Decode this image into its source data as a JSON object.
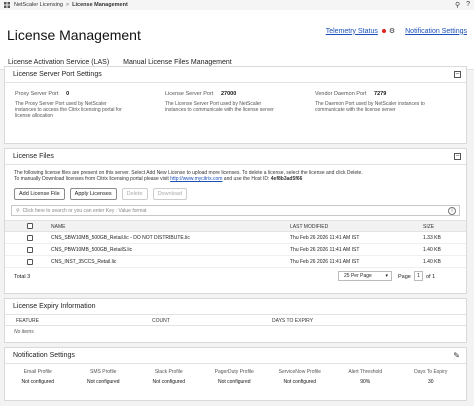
{
  "topbar": {
    "app": "NetScaler Licensing",
    "separator": ">",
    "current": "License Management"
  },
  "header": {
    "title": "License Management",
    "telemetry_link": "Telemetry Status",
    "notification_link": "Notification Settings",
    "telemetry_dot_color": "#e2231a"
  },
  "tabs": [
    {
      "label": "License Activation Service (LAS)"
    },
    {
      "label": "Manual License Files Management"
    }
  ],
  "ports_panel": {
    "title": "License Server Port Settings",
    "items": [
      {
        "label": "Proxy Server Port",
        "value": "0",
        "desc": "The Proxy Server Port used by NetScaler instances to access the Citrix licensing portal for license allocation"
      },
      {
        "label": "License Server Port",
        "value": "27000",
        "desc": "The License Server Port used by NetScaler instances to communicate with the license server"
      },
      {
        "label": "Vendor Daemon Port",
        "value": "7279",
        "desc": "The Daemon Port used by NetScaler instances to communicate with the license server"
      }
    ]
  },
  "files_panel": {
    "title": "License Files",
    "desc_line1": "The following license files are present on this server. Select Add New License to upload more licenses. To delete a license, select the license and click Delete.",
    "desc_line2_prefix": "To manually Download licenses from Citrix licensing portal please visit ",
    "desc_link": "http://www.mycitrix.com",
    "desc_line2_suffix": " and use the Host ID: ",
    "host_id": "4ef8b3ad5f66",
    "buttons": {
      "add": "Add License File",
      "apply": "Apply Licenses",
      "delete": "Delete",
      "download": "Download"
    },
    "search_placeholder": "Click here to search or you can enter Key : Value format",
    "columns": {
      "name": "NAME",
      "modified": "LAST MODIFIED",
      "size": "SIZE"
    },
    "rows": [
      {
        "name": "CNS_SBW10MB_500GB_Retail.lic - DO NOT DISTRIBUTE.lic",
        "modified": "Thu Feb 26 2026 11:41 AM IST",
        "size": "1.33 KB"
      },
      {
        "name": "CNS_PBW10MB_500GB_RetailS.lic",
        "modified": "Thu Feb 26 2026 11:41 AM IST",
        "size": "1.40 KB"
      },
      {
        "name": "CNS_INST_35CCS_Retail.lic",
        "modified": "Thu Feb 26 2026 11:41 AM IST",
        "size": "1.40 KB"
      }
    ],
    "total": "Total 3",
    "per_page": "25 Per Page",
    "page_label": "Page",
    "page_value": "1",
    "of_label": "of 1"
  },
  "expiry_panel": {
    "title": "License Expiry Information",
    "columns": {
      "feature": "FEATURE",
      "count": "COUNT",
      "days": "DAYS TO EXPIRY"
    },
    "empty": "No items"
  },
  "notif_panel": {
    "title": "Notification Settings",
    "items": [
      {
        "label": "Email Profile",
        "value": "Not configured"
      },
      {
        "label": "SMS Profile",
        "value": "Not configured"
      },
      {
        "label": "Slack Profile",
        "value": "Not configured"
      },
      {
        "label": "PagerDuty Profile",
        "value": "Not configured"
      },
      {
        "label": "ServiceNow Profile",
        "value": "Not configured"
      },
      {
        "label": "Alert Threshold",
        "value": "90%"
      },
      {
        "label": "Days To Expiry",
        "value": "30"
      }
    ]
  }
}
